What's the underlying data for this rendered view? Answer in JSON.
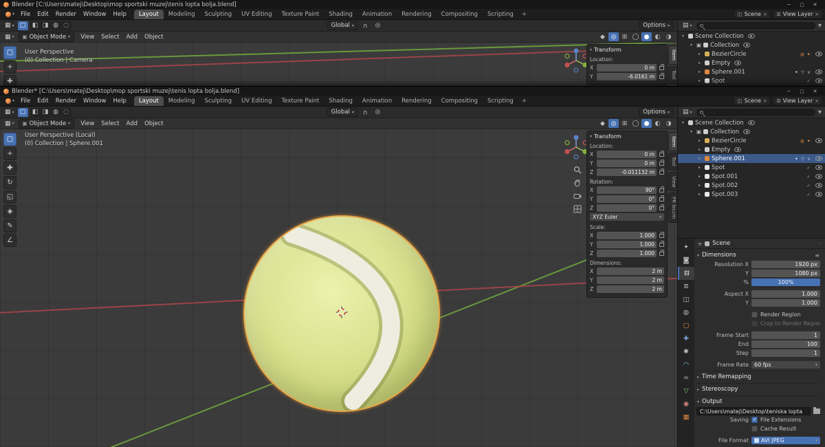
{
  "chrome": {
    "menus": [
      "File",
      "Edit",
      "Render",
      "Window",
      "Help"
    ],
    "workspaces": [
      "Layout",
      "Modeling",
      "Sculpting",
      "UV Editing",
      "Texture Paint",
      "Shading",
      "Animation",
      "Rendering",
      "Compositing",
      "Scripting"
    ],
    "active_workspace": "Layout",
    "new_tab_label": "+",
    "mode_label": "Object Mode",
    "viewport_menus": [
      "View",
      "Select",
      "Add",
      "Object"
    ],
    "orientation_label": "Global",
    "options_label": "Options",
    "scene_selector_label": "Scene",
    "view_layer_selector_label": "View Layer",
    "caret_down": "▾",
    "caret_right": "▸",
    "accent_color": "#4772b3",
    "selection_outline_color": "#ed9d3c",
    "window_buttons": [
      {
        "name": "minimize",
        "glyph": "─"
      },
      {
        "name": "maximize",
        "glyph": "▢"
      },
      {
        "name": "close",
        "glyph": "✕"
      }
    ],
    "icons": {
      "editor_viewport": "▦",
      "editor_outliner": "▤",
      "editor_properties": "≡",
      "mode_icon": "▣",
      "magnet": "∪",
      "proportional": "◎",
      "funnel": "▼",
      "presets": "≡",
      "pin": "◦",
      "x_small": "✕"
    },
    "select_modes": [
      {
        "name": "select-mode-tweak",
        "glyph": "◧"
      },
      {
        "name": "select-mode-box",
        "glyph": "◨"
      },
      {
        "name": "select-mode-circle",
        "glyph": "◍"
      },
      {
        "name": "select-mode-lasso",
        "glyph": "◌"
      }
    ],
    "viewport_toggles": [
      {
        "name": "toggle-gizmos",
        "glyph": "◆"
      },
      {
        "name": "toggle-overlays",
        "glyph": "◎",
        "active": true
      },
      {
        "name": "toggle-xray",
        "glyph": "⊞"
      },
      {
        "name": "shading-wireframe",
        "glyph": "◯"
      },
      {
        "name": "shading-solid",
        "glyph": "●",
        "active": true
      },
      {
        "name": "shading-material",
        "glyph": "◐"
      },
      {
        "name": "shading-rendered",
        "glyph": "◑"
      }
    ],
    "tools": [
      {
        "name": "tool-select-box",
        "glyph": "▢",
        "active": true
      },
      {
        "name": "tool-cursor",
        "glyph": "+"
      },
      {
        "name": "tool-move",
        "glyph": "✚"
      },
      {
        "name": "tool-rotate",
        "glyph": "↻"
      },
      {
        "name": "tool-scale",
        "glyph": "◱"
      },
      {
        "name": "tool-transform",
        "glyph": "◈"
      },
      {
        "name": "tool-annotate",
        "glyph": "✎"
      },
      {
        "name": "tool-measure",
        "glyph": "∠"
      }
    ]
  },
  "top_window": {
    "title": "Blender [C:\\Users\\matej\\Desktop\\mop sportski muzej\\tenis lopta bolja.blend]",
    "viewport_mode": "User Perspective",
    "viewport_context": "(0) Collection | Camera",
    "npanel": {
      "header": "Transform",
      "location_label": "Location:",
      "rows": [
        {
          "axis": "X",
          "value": "0 m"
        },
        {
          "axis": "Y",
          "value": "-6.0161 m"
        }
      ],
      "tabs": [
        {
          "label": "Item",
          "active": true
        },
        {
          "label": "Tool"
        }
      ]
    },
    "outliner_rows": [
      {
        "label": "Scene Collection",
        "depth": 0,
        "caret": "▾",
        "icon_color": "#cfcfcf"
      },
      {
        "label": "Collection",
        "depth": 1,
        "caret": "▾",
        "check_glyph": "▣",
        "icon_color": "#cfcfcf"
      },
      {
        "label": "BezierCircle",
        "depth": 2,
        "caret": "▸",
        "icon_color": "#d8b05a",
        "extra": "◍ ✦",
        "extra_color": "#e0883f"
      },
      {
        "label": "Empty",
        "depth": 2,
        "caret": "▸",
        "icon_color": "#cfcfcf"
      },
      {
        "label": "Sphere.001",
        "depth": 2,
        "caret": "▸",
        "icon_color": "#e0883f",
        "extra": "✦ ▽ ∨",
        "extra_color": "#9fc3e8"
      },
      {
        "label": "Spot",
        "depth": 2,
        "caret": "▸",
        "icon_color": "#e8e8e8",
        "extra": "✓",
        "extra_color": "#7dc87d"
      }
    ]
  },
  "bottom_window": {
    "title": "Blender* [C:\\Users\\matej\\Desktop\\mop sportski muzej\\tenis lopta bolja.blend]",
    "viewport_mode": "User Perspective (Local)",
    "viewport_context": "(0) Collection | Sphere.001",
    "npanel": {
      "header": "Transform",
      "rotation_mode": "XYZ Euler",
      "tabs": [
        {
          "label": "Item",
          "active": true
        },
        {
          "label": "Tool"
        },
        {
          "label": "View"
        },
        {
          "label": "PR loccm"
        }
      ],
      "groups": [
        {
          "label": "Location:",
          "rows": [
            {
              "axis": "X",
              "value": "0 m"
            },
            {
              "axis": "Y",
              "value": "0 m"
            },
            {
              "axis": "Z",
              "value": "-0.011132 m"
            }
          ]
        },
        {
          "label": "Rotation:",
          "rows": [
            {
              "axis": "X",
              "value": "90°"
            },
            {
              "axis": "Y",
              "value": "0°"
            },
            {
              "axis": "Z",
              "value": "0°"
            }
          ]
        },
        {
          "label": "Scale:",
          "rows": [
            {
              "axis": "X",
              "value": "1.000"
            },
            {
              "axis": "Y",
              "value": "1.000"
            },
            {
              "axis": "Z",
              "value": "1.000"
            }
          ]
        },
        {
          "label": "Dimensions:",
          "rows": [
            {
              "axis": "X",
              "value": "2 m"
            },
            {
              "axis": "Y",
              "value": "2 m"
            },
            {
              "axis": "Z",
              "value": "2 m"
            }
          ]
        }
      ]
    },
    "outliner_rows": [
      {
        "label": "Scene Collection",
        "depth": 0,
        "caret": "▾",
        "icon_color": "#cfcfcf"
      },
      {
        "label": "Collection",
        "depth": 1,
        "caret": "▾",
        "check_glyph": "▣",
        "icon_color": "#cfcfcf"
      },
      {
        "label": "BezierCircle",
        "depth": 2,
        "caret": "▸",
        "icon_color": "#d8b05a",
        "extra": "◍ ✦",
        "extra_color": "#e0883f"
      },
      {
        "label": "Empty",
        "depth": 2,
        "caret": "▸",
        "icon_color": "#cfcfcf"
      },
      {
        "label": "Sphere.001",
        "depth": 2,
        "caret": "▸",
        "icon_color": "#e0883f",
        "selected": true,
        "extra": "✦ ▽ ∨",
        "extra_color": "#bcd2ea"
      },
      {
        "label": "Spot",
        "depth": 2,
        "caret": "▸",
        "icon_color": "#e8e8e8",
        "extra": "✓",
        "extra_color": "#7dc87d"
      },
      {
        "label": "Spot.001",
        "depth": 2,
        "caret": "▸",
        "icon_color": "#e8e8e8",
        "extra": "✓",
        "extra_color": "#7dc87d"
      },
      {
        "label": "Spot.002",
        "depth": 2,
        "caret": "▸",
        "icon_color": "#e8e8e8",
        "extra": "✓",
        "extra_color": "#7dc87d"
      },
      {
        "label": "Spot.003",
        "depth": 2,
        "caret": "▸",
        "icon_color": "#e8e8e8",
        "extra": "✓",
        "extra_color": "#7dc87d"
      }
    ],
    "props_tabs": [
      {
        "name": "tool",
        "glyph": "✦",
        "color": "#b8b8b8"
      },
      {
        "name": "render",
        "glyph": "◙",
        "color": "#b8b8b8"
      },
      {
        "name": "output",
        "glyph": "⊟",
        "color": "#ffffff",
        "active": true
      },
      {
        "name": "view-layer",
        "glyph": "≣",
        "color": "#b8b8b8"
      },
      {
        "name": "scene",
        "glyph": "◫",
        "color": "#b8b8b8"
      },
      {
        "name": "world",
        "glyph": "◍",
        "color": "#b8b8b8"
      },
      {
        "name": "object",
        "glyph": "▢",
        "color": "#e0883f"
      },
      {
        "name": "modifiers",
        "glyph": "✚",
        "color": "#7aa5d8"
      },
      {
        "name": "particles",
        "glyph": "✱",
        "color": "#b8b8b8"
      },
      {
        "name": "physics",
        "glyph": "◠",
        "color": "#8fd0e8"
      },
      {
        "name": "constraints",
        "glyph": "∞",
        "color": "#b8b8b8"
      },
      {
        "name": "object-data",
        "glyph": "▽",
        "color": "#7dc87d"
      },
      {
        "name": "material",
        "glyph": "◉",
        "color": "#d9857a"
      },
      {
        "name": "texture",
        "glyph": "▦",
        "color": "#e0883f"
      }
    ],
    "props": {
      "breadcrumb_scene": "Scene",
      "dimensions_header": "Dimensions",
      "resolution_x_label": "Resolution X",
      "resolution_x_value": "1920 px",
      "resolution_y_label": "Y",
      "resolution_y_value": "1080 px",
      "resolution_pct_label": "%",
      "resolution_pct_value": "100%",
      "aspect_x_label": "Aspect X",
      "aspect_x_value": "1.000",
      "aspect_y_label": "Y",
      "aspect_y_value": "1.000",
      "render_region_label": "Render Region",
      "render_region_checked": false,
      "crop_render_region_label": "Crop to Render Region",
      "crop_render_region_checked": false,
      "frame_start_label": "Frame Start",
      "frame_start_value": "1",
      "frame_end_label": "End",
      "frame_end_value": "100",
      "frame_step_label": "Step",
      "frame_step_value": "1",
      "frame_rate_label": "Frame Rate",
      "frame_rate_value": "60 fps",
      "time_remapping_header": "Time Remapping",
      "stereoscopy_header": "Stereoscopy",
      "output_header": "Output",
      "output_path_value": "C:\\Users\\matej\\Desktop\\teniska lopta",
      "saving_label": "Saving",
      "file_extensions_label": "File Extensions",
      "file_extensions_checked": true,
      "cache_result_label": "Cache Result",
      "cache_result_checked": false,
      "file_format_label": "File Format",
      "file_format_value": "AVI JPEG"
    }
  }
}
